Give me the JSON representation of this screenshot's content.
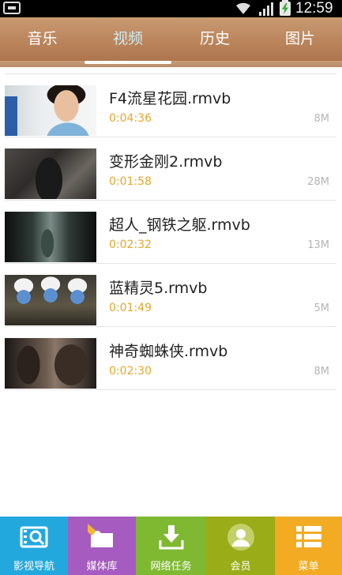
{
  "status_bar": {
    "time": "12:59"
  },
  "tabs": [
    {
      "label": "音乐",
      "active": false
    },
    {
      "label": "视频",
      "active": true
    },
    {
      "label": "历史",
      "active": false
    },
    {
      "label": "图片",
      "active": false
    }
  ],
  "videos": [
    {
      "title": "F4流星花园.rmvb",
      "duration": "0:04:36",
      "size": "8M"
    },
    {
      "title": "变形金刚2.rmvb",
      "duration": "0:01:58",
      "size": "28M"
    },
    {
      "title": "超人_钢铁之躯.rmvb",
      "duration": "0:02:32",
      "size": "13M"
    },
    {
      "title": "蓝精灵5.rmvb",
      "duration": "0:01:49",
      "size": "5M"
    },
    {
      "title": "神奇蜘蛛侠.rmvb",
      "duration": "0:02:30",
      "size": "8M"
    }
  ],
  "bottom_nav": [
    {
      "label": "影视导航",
      "icon": "film-navigation-icon",
      "color": "#23a8de"
    },
    {
      "label": "媒体库",
      "icon": "media-library-folder-icon",
      "color": "#a55bbf"
    },
    {
      "label": "网络任务",
      "icon": "download-icon",
      "color": "#7fb932"
    },
    {
      "label": "会员",
      "icon": "member-icon",
      "color": "#9aac17"
    },
    {
      "label": "菜单",
      "icon": "menu-list-icon",
      "color": "#f2ab23"
    }
  ],
  "colors": {
    "tabbar": "#b98259",
    "duration": "#e8a52c",
    "active_tab": "#cdebf5"
  }
}
